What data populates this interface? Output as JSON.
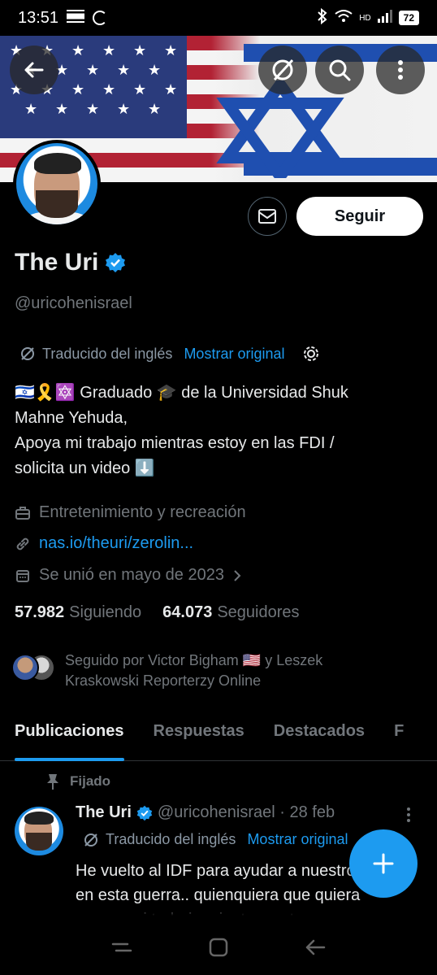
{
  "status_bar": {
    "time": "13:51",
    "network": "HD",
    "battery": "72"
  },
  "header": {
    "back_icon": "arrow-left-icon",
    "translate_icon": "translate-off-icon",
    "search_icon": "search-icon",
    "more_icon": "more-vertical-icon"
  },
  "profile": {
    "name": "The Uri",
    "handle": "@uricohenisrael",
    "follow_label": "Seguir",
    "translated_label": "Traducido del inglés",
    "show_original_label": "Mostrar original",
    "bio_lines": [
      "🇮🇱🎗️🔯 Graduado 🎓 de la Universidad Shuk",
      "Mahne Yehuda,",
      "Apoya mi trabajo mientras estoy en las FDI /",
      "solicita un video ⬇️"
    ],
    "category": "Entretenimiento y recreación",
    "link": "nas.io/theuri/zerolin...",
    "joined": "Se unió en mayo de 2023",
    "following_count": "57.982",
    "following_label": "Siguiendo",
    "followers_count": "64.073",
    "followers_label": "Seguidores",
    "followed_by": "Seguido por Victor Bigham 🇺🇸 y Leszek Kraskowski Reporterzy Online"
  },
  "tabs": [
    "Publicaciones",
    "Respuestas",
    "Destacados",
    "F"
  ],
  "pinned_tweet": {
    "pinned_label": "Fijado",
    "name": "The Uri",
    "handle_date": "@uricohenisrael · 28 feb",
    "translated_label": "Traducido del inglés",
    "show_original_label": "Mostrar original",
    "text": "He vuelto al IDF para ayudar a nuestro país en esta guerra.. quienquiera que quiera apoyar mi trabajo mientras estoy"
  },
  "colors": {
    "accent": "#1d9bf0",
    "background": "#000000",
    "muted": "#71767b"
  }
}
